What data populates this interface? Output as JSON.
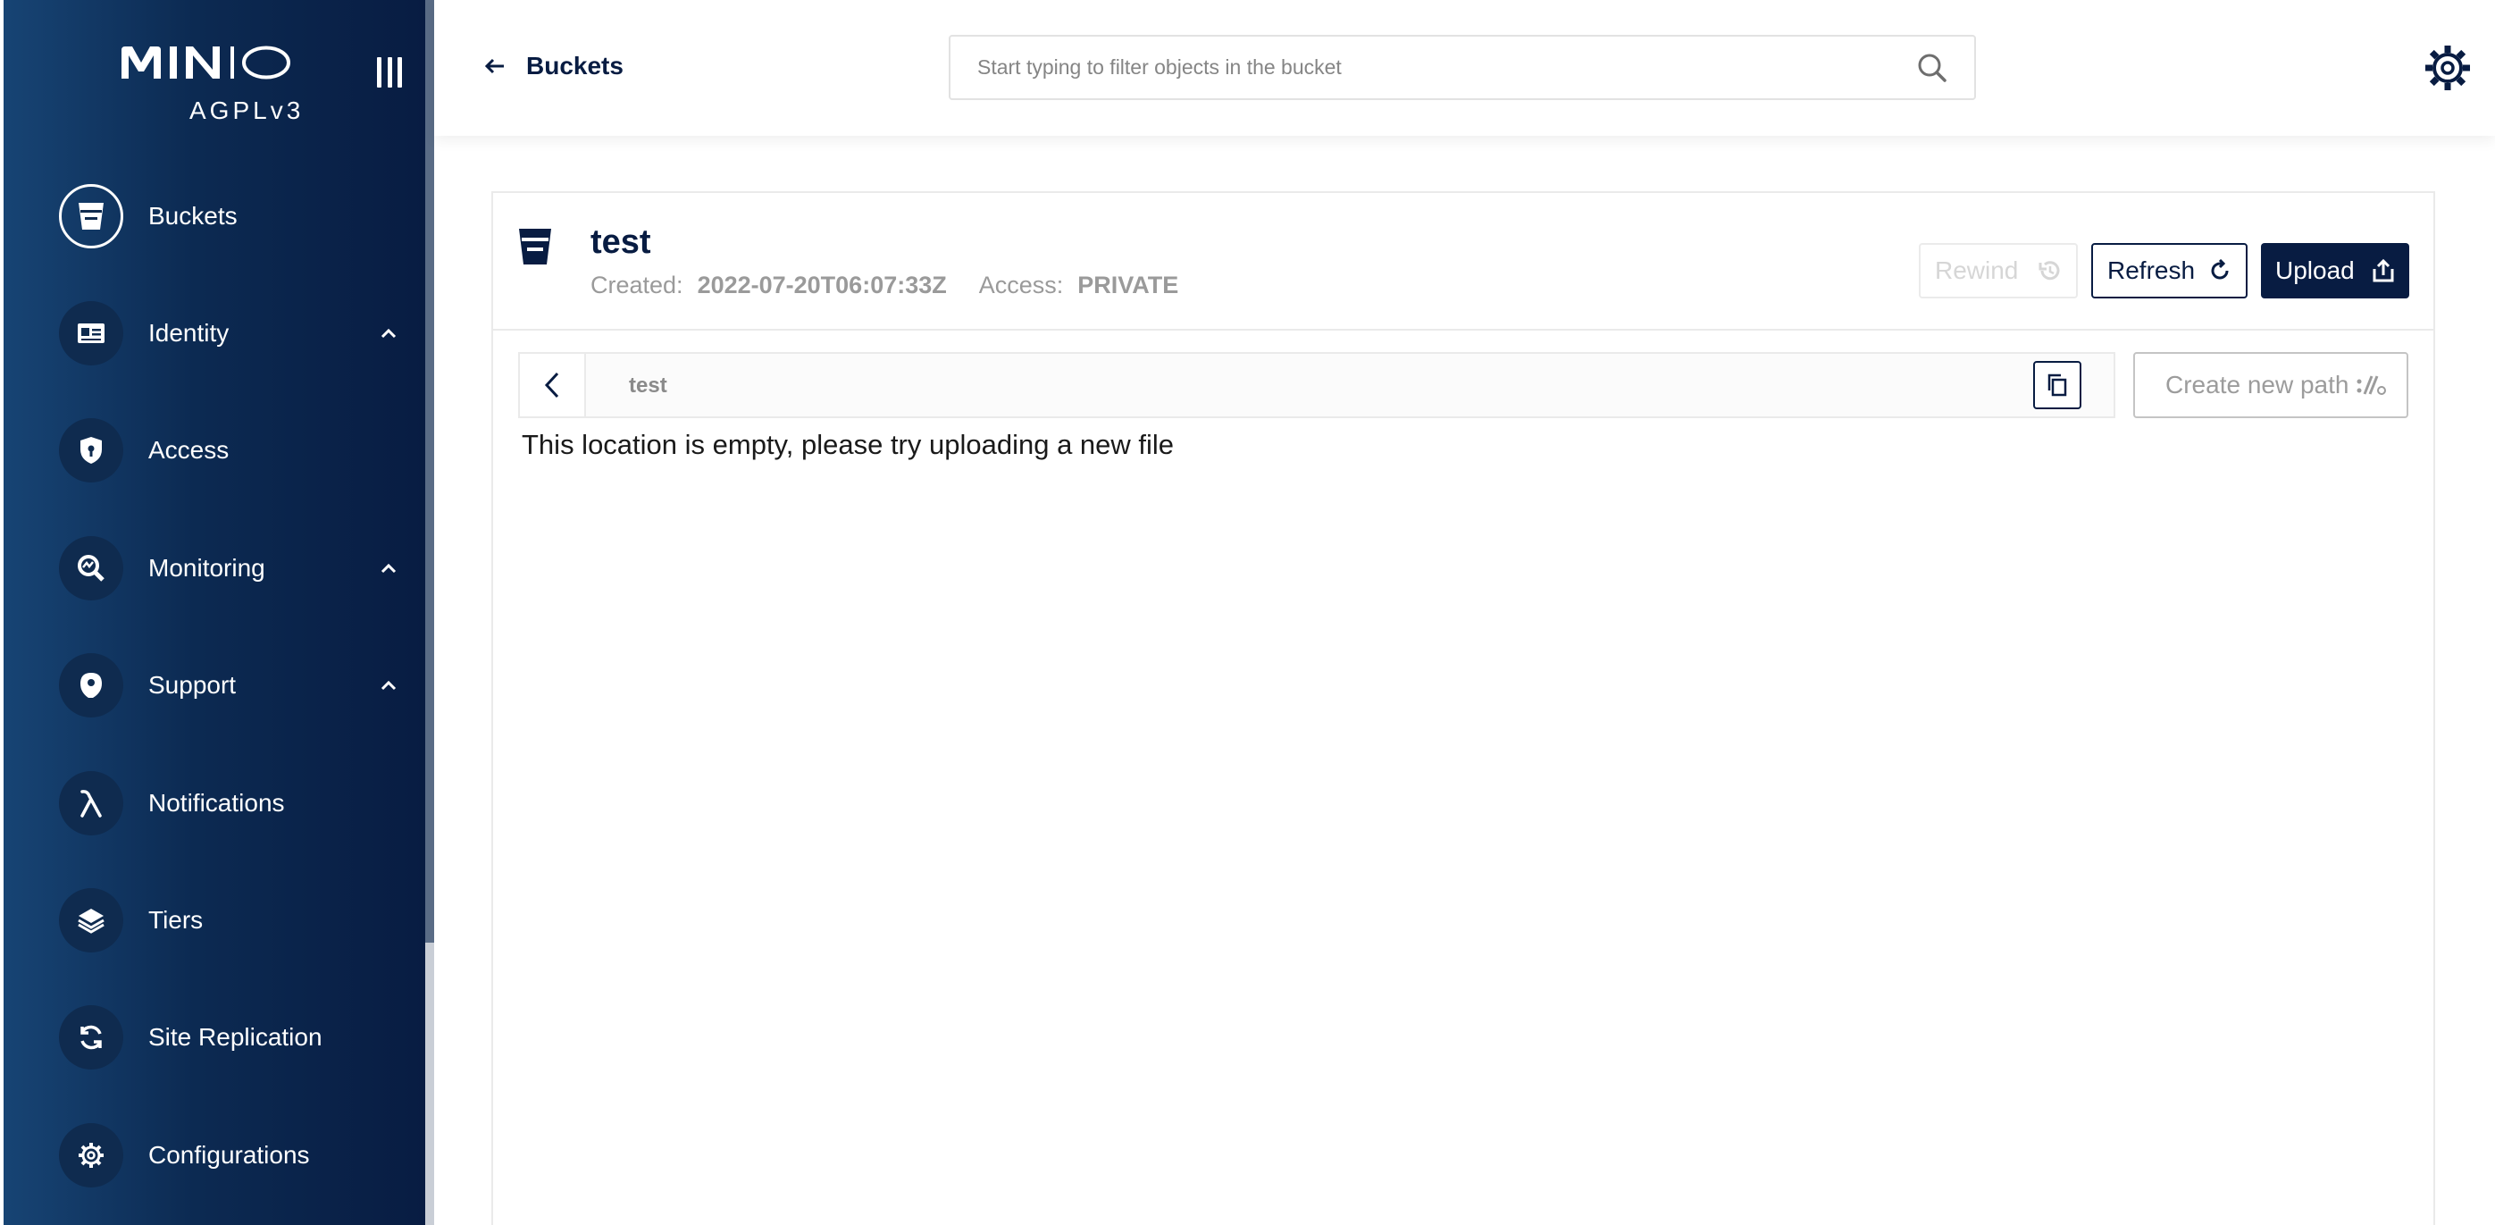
{
  "sidebar": {
    "logo_text": "MINIO",
    "license": "AGPLv3",
    "items": [
      {
        "label": "Buckets",
        "icon": "bucket-icon",
        "active": true,
        "expandable": false
      },
      {
        "label": "Identity",
        "icon": "id-card-icon",
        "active": false,
        "expandable": true
      },
      {
        "label": "Access",
        "icon": "lock-icon",
        "active": false,
        "expandable": false
      },
      {
        "label": "Monitoring",
        "icon": "monitoring-icon",
        "active": false,
        "expandable": true
      },
      {
        "label": "Support",
        "icon": "support-icon",
        "active": false,
        "expandable": true
      },
      {
        "label": "Notifications",
        "icon": "lambda-icon",
        "active": false,
        "expandable": false
      },
      {
        "label": "Tiers",
        "icon": "layers-icon",
        "active": false,
        "expandable": false
      },
      {
        "label": "Site Replication",
        "icon": "sync-icon",
        "active": false,
        "expandable": false
      },
      {
        "label": "Configurations",
        "icon": "gear-icon",
        "active": false,
        "expandable": false
      }
    ]
  },
  "header": {
    "back_label": "Buckets",
    "search_placeholder": "Start typing to filter objects in the bucket",
    "search_value": ""
  },
  "bucket": {
    "name": "test",
    "created_label": "Created:",
    "created_value": "2022-07-20T06:07:33Z",
    "access_label": "Access:",
    "access_value": "PRIVATE"
  },
  "toolbar": {
    "rewind_label": "Rewind",
    "refresh_label": "Refresh",
    "upload_label": "Upload"
  },
  "path": {
    "current": "test",
    "create_label": "Create new path"
  },
  "content": {
    "empty_message": "This location is empty, please try uploading a new file"
  },
  "colors": {
    "brand_dark": "#081c42",
    "sidebar_gradient_start": "#174474",
    "muted_text": "#9a9a9a"
  }
}
